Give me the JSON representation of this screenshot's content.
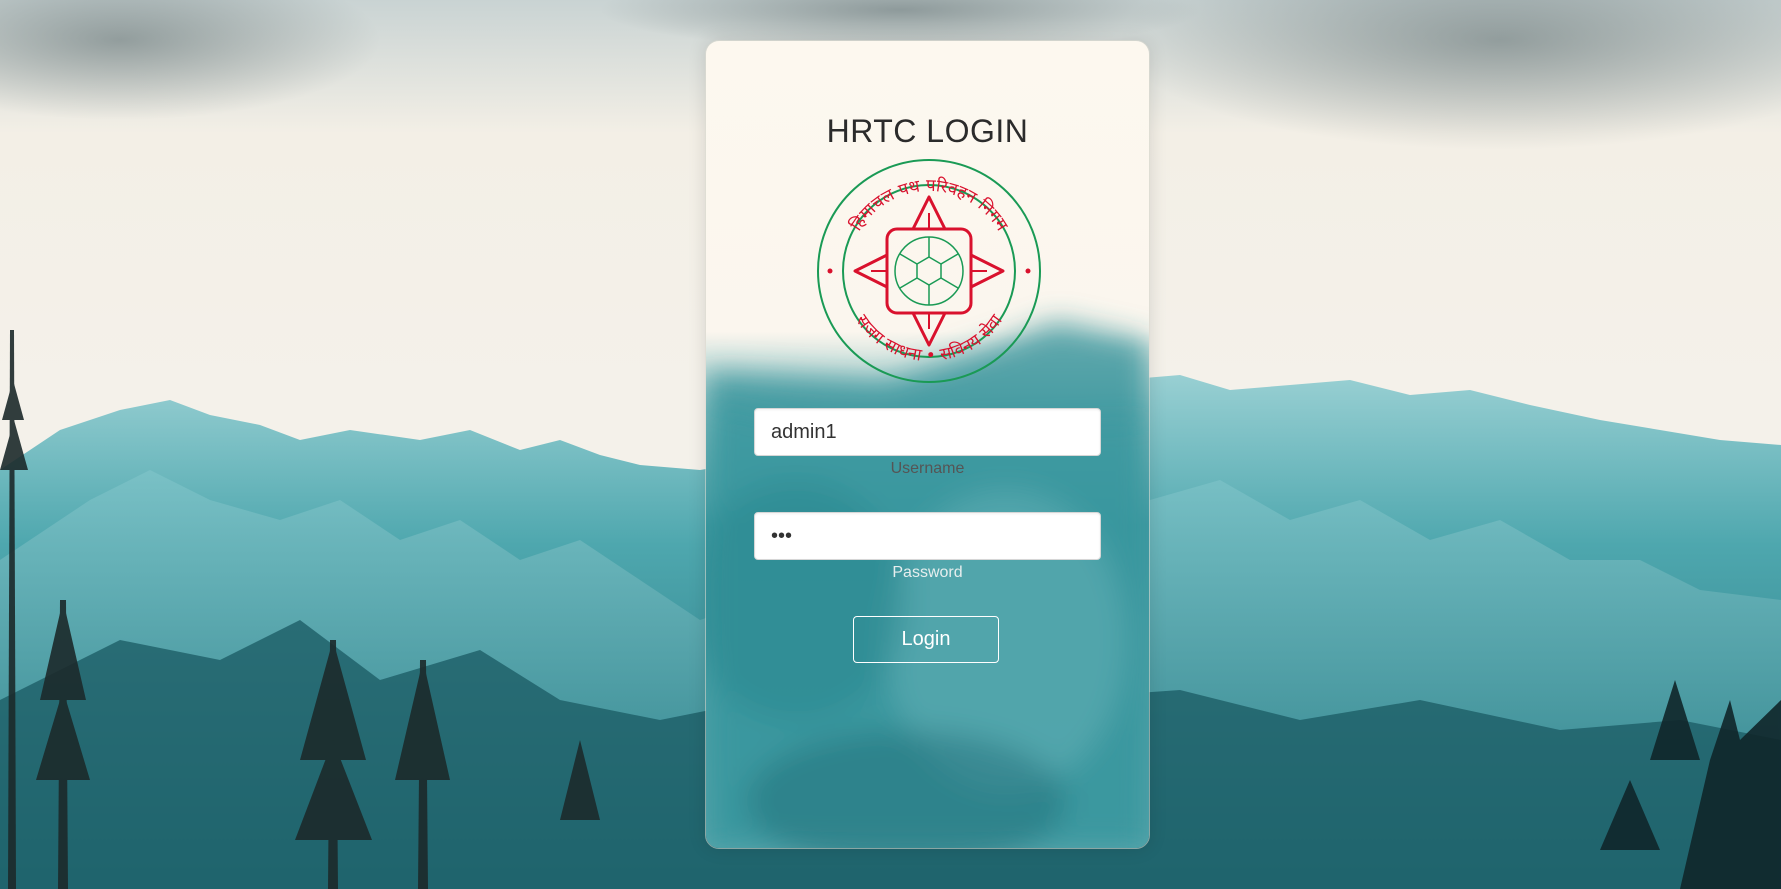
{
  "login": {
    "title": "HRTC LOGIN",
    "logo_name": "hrtc-emblem",
    "logo_text_top": "हिमाचल पथ परिवहन निगम",
    "logo_text_bottom": "सजग साधना • सविनय सेवा",
    "username": {
      "value": "admin1",
      "label": "Username"
    },
    "password": {
      "value": "•••",
      "label": "Password"
    },
    "button_label": "Login"
  },
  "colors": {
    "emblem_red": "#d9112d",
    "emblem_green": "#1a9a55",
    "mountain_teal": "#3a9aa3"
  }
}
